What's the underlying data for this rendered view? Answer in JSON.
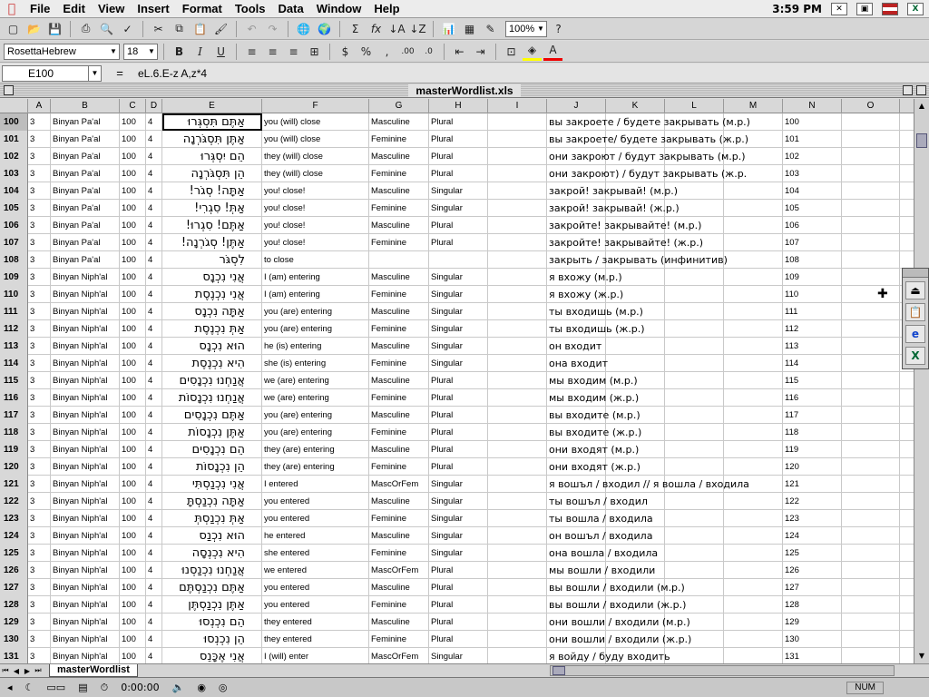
{
  "menubar": {
    "items": [
      "File",
      "Edit",
      "View",
      "Insert",
      "Format",
      "Tools",
      "Data",
      "Window",
      "Help"
    ],
    "clock": "3:59 PM"
  },
  "toolbar": {
    "zoom": "100%",
    "font": "RosettaHebrew",
    "size": "18"
  },
  "formula_bar": {
    "cell_ref": "E100",
    "equals": "=",
    "formula": "eL.6.E-z A,z*4"
  },
  "window": {
    "title": "masterWordlist.xls"
  },
  "columns": [
    "A",
    "B",
    "C",
    "D",
    "E",
    "F",
    "G",
    "H",
    "I",
    "J",
    "K",
    "L",
    "M",
    "N",
    "O"
  ],
  "rows": [
    {
      "n": "100",
      "a": "3",
      "b": "Binyan Pa'al",
      "c": "100",
      "d": "4",
      "e": "אַתֶּם תִּסְגְּרוּ",
      "f": "you (will) close",
      "g": "Masculine",
      "h": "Plural",
      "j": "вы закроете / будете закрывать (м.р.)"
    },
    {
      "n": "101",
      "a": "3",
      "b": "Binyan Pa'al",
      "c": "100",
      "d": "4",
      "e": "אַתֶּן תִּסְגֹּרְנָה",
      "f": "you (will) close",
      "g": "Feminine",
      "h": "Plural",
      "j": "вы закроете/ будете закрывать (ж.р.)"
    },
    {
      "n": "102",
      "a": "3",
      "b": "Binyan Pa'al",
      "c": "100",
      "d": "4",
      "e": "הֵם יִסְגְּרוּ",
      "f": "they (will) close",
      "g": "Masculine",
      "h": "Plural",
      "j": "они закроют / будут закрывать (м.р.)"
    },
    {
      "n": "103",
      "a": "3",
      "b": "Binyan Pa'al",
      "c": "100",
      "d": "4",
      "e": "הֵן תִּסְגֹּרְנָה",
      "f": "they (will) close",
      "g": "Feminine",
      "h": "Plural",
      "j": "они закроют) / будут закрывать (ж.р."
    },
    {
      "n": "104",
      "a": "3",
      "b": "Binyan Pa'al",
      "c": "100",
      "d": "4",
      "e": "אַתָּה! סְגֹר!",
      "f": "you! close!",
      "g": "Masculine",
      "h": "Singular",
      "j": "закрой! закрывай! (м.р.)"
    },
    {
      "n": "105",
      "a": "3",
      "b": "Binyan Pa'al",
      "c": "100",
      "d": "4",
      "e": "אַתְּ! סִגְרִי!",
      "f": "you! close!",
      "g": "Feminine",
      "h": "Singular",
      "j": "закрой! закрывай! (ж.р.)"
    },
    {
      "n": "106",
      "a": "3",
      "b": "Binyan Pa'al",
      "c": "100",
      "d": "4",
      "e": "אַתֶּם! סִגְרוּ!",
      "f": "you! close!",
      "g": "Masculine",
      "h": "Plural",
      "j": "закройте! закрывайте! (м.р.)"
    },
    {
      "n": "107",
      "a": "3",
      "b": "Binyan Pa'al",
      "c": "100",
      "d": "4",
      "e": "אַתֶּן! סְגֹרְנָה!",
      "f": "you! close!",
      "g": "Feminine",
      "h": "Plural",
      "j": "закройте! закрывайте! (ж.р.)"
    },
    {
      "n": "108",
      "a": "3",
      "b": "Binyan Pa'al",
      "c": "100",
      "d": "4",
      "e": "לִסְגֹּר",
      "f": "to close",
      "g": "",
      "h": "",
      "j": "закрыть / закрывать (инфинитив)"
    },
    {
      "n": "109",
      "a": "3",
      "b": "Binyan Niph'al",
      "c": "100",
      "d": "4",
      "e": "אֲנִי נִכְנָס",
      "f": "I (am) entering",
      "g": "Masculine",
      "h": "Singular",
      "j": "я вхожу (м.р.)"
    },
    {
      "n": "110",
      "a": "3",
      "b": "Binyan Niph'al",
      "c": "100",
      "d": "4",
      "e": "אֲנִי נִכְנֶסֶת",
      "f": "I (am) entering",
      "g": "Feminine",
      "h": "Singular",
      "j": "я вхожу (ж.р.)"
    },
    {
      "n": "111",
      "a": "3",
      "b": "Binyan Niph'al",
      "c": "100",
      "d": "4",
      "e": "אַתָּה נִכְנָס",
      "f": "you (are) entering",
      "g": "Masculine",
      "h": "Singular",
      "j": "ты входишь (м.р.)"
    },
    {
      "n": "112",
      "a": "3",
      "b": "Binyan Niph'al",
      "c": "100",
      "d": "4",
      "e": "אַתְּ נִכְנֶסֶת",
      "f": "you (are) entering",
      "g": "Feminine",
      "h": "Singular",
      "j": "ты входишь (ж.р.)"
    },
    {
      "n": "113",
      "a": "3",
      "b": "Binyan Niph'al",
      "c": "100",
      "d": "4",
      "e": "הוּא נִכְנָס",
      "f": "he (is) entering",
      "g": "Masculine",
      "h": "Singular",
      "j": "он входит"
    },
    {
      "n": "114",
      "a": "3",
      "b": "Binyan Niph'al",
      "c": "100",
      "d": "4",
      "e": "הִיא נִכְנֶסֶת",
      "f": "she (is) entering",
      "g": "Feminine",
      "h": "Singular",
      "j": "она входит"
    },
    {
      "n": "115",
      "a": "3",
      "b": "Binyan Niph'al",
      "c": "100",
      "d": "4",
      "e": "אֲנַחְנוּ נִכְנָסִים",
      "f": "we (are) entering",
      "g": "Masculine",
      "h": "Plural",
      "j": "мы входим (м.р.)"
    },
    {
      "n": "116",
      "a": "3",
      "b": "Binyan Niph'al",
      "c": "100",
      "d": "4",
      "e": "אֲנַחְנוּ נִכְנָסוֹת",
      "f": "we (are) entering",
      "g": "Feminine",
      "h": "Plural",
      "j": "мы входим (ж.р.)"
    },
    {
      "n": "117",
      "a": "3",
      "b": "Binyan Niph'al",
      "c": "100",
      "d": "4",
      "e": "אַתֶּם נִכְנָסִים",
      "f": "you (are) entering",
      "g": "Masculine",
      "h": "Plural",
      "j": "вы входите (м.р.)"
    },
    {
      "n": "118",
      "a": "3",
      "b": "Binyan Niph'al",
      "c": "100",
      "d": "4",
      "e": "אַתֶּן נִכְנָסוֹת",
      "f": "you (are) entering",
      "g": "Feminine",
      "h": "Plural",
      "j": "вы входите (ж.р.)"
    },
    {
      "n": "119",
      "a": "3",
      "b": "Binyan Niph'al",
      "c": "100",
      "d": "4",
      "e": "הֵם נִכְנָסִים",
      "f": "they (are) entering",
      "g": "Masculine",
      "h": "Plural",
      "j": "они входят (м.р.)"
    },
    {
      "n": "120",
      "a": "3",
      "b": "Binyan Niph'al",
      "c": "100",
      "d": "4",
      "e": "הֵן נִכְנָסוֹת",
      "f": "they (are) entering",
      "g": "Feminine",
      "h": "Plural",
      "j": "они входят (ж.р.)"
    },
    {
      "n": "121",
      "a": "3",
      "b": "Binyan Niph'al",
      "c": "100",
      "d": "4",
      "e": "אֲנִי נִכְנַסְתִּי",
      "f": "I entered",
      "g": "MascOrFem",
      "h": "Singular",
      "j": "я вошъл / входил  // я вошла / входила"
    },
    {
      "n": "122",
      "a": "3",
      "b": "Binyan Niph'al",
      "c": "100",
      "d": "4",
      "e": "אַתָּה נִכְנַסְתָּ",
      "f": "you entered",
      "g": "Masculine",
      "h": "Singular",
      "j": "ты вошъл / входил"
    },
    {
      "n": "123",
      "a": "3",
      "b": "Binyan Niph'al",
      "c": "100",
      "d": "4",
      "e": "אַתְּ נִכְנַסְתְּ",
      "f": "you entered",
      "g": "Feminine",
      "h": "Singular",
      "j": "ты вошла / входила"
    },
    {
      "n": "124",
      "a": "3",
      "b": "Binyan Niph'al",
      "c": "100",
      "d": "4",
      "e": "הוּא נִכְנַס",
      "f": "he entered",
      "g": "Masculine",
      "h": "Singular",
      "j": "он вошъл / входила"
    },
    {
      "n": "125",
      "a": "3",
      "b": "Binyan Niph'al",
      "c": "100",
      "d": "4",
      "e": "הִיא נִכְנְסָה",
      "f": "she entered",
      "g": "Feminine",
      "h": "Singular",
      "j": "она вошла / входила"
    },
    {
      "n": "126",
      "a": "3",
      "b": "Binyan Niph'al",
      "c": "100",
      "d": "4",
      "e": "אֲנַחְנוּ נִכְנַסְנוּ",
      "f": "we entered",
      "g": "MascOrFem",
      "h": "Plural",
      "j": "мы вошли / входили"
    },
    {
      "n": "127",
      "a": "3",
      "b": "Binyan Niph'al",
      "c": "100",
      "d": "4",
      "e": "אַתֶּם נִכְנַסְתֶּם",
      "f": "you entered",
      "g": "Masculine",
      "h": "Plural",
      "j": "вы вошли / входили (м.р.)"
    },
    {
      "n": "128",
      "a": "3",
      "b": "Binyan Niph'al",
      "c": "100",
      "d": "4",
      "e": "אַתֶּן נִכְנַסְתֶּן",
      "f": "you entered",
      "g": "Feminine",
      "h": "Plural",
      "j": "вы вошли / входили (ж.р.)"
    },
    {
      "n": "129",
      "a": "3",
      "b": "Binyan Niph'al",
      "c": "100",
      "d": "4",
      "e": "הֵם נִכְנְסוּ",
      "f": "they entered",
      "g": "Masculine",
      "h": "Plural",
      "j": "они вошли / входили (м.р.)"
    },
    {
      "n": "130",
      "a": "3",
      "b": "Binyan Niph'al",
      "c": "100",
      "d": "4",
      "e": "הֵן נִכְנְסוּ",
      "f": "they entered",
      "g": "Feminine",
      "h": "Plural",
      "j": "они вошли / входили (ж.р.)"
    },
    {
      "n": "131",
      "a": "3",
      "b": "Binyan Niph'al",
      "c": "100",
      "d": "4",
      "e": "אֲנִי אֶכָּנֵס",
      "f": "I (will) enter",
      "g": "MascOrFem",
      "h": "Singular",
      "j": "я войду / буду входить"
    }
  ],
  "sheet_tab": "masterWordlist",
  "control_strip": {
    "time": "0:00:00"
  },
  "status": {
    "num": "NUM"
  },
  "colors": {
    "selection": "#000000",
    "header_bg": "#d8d8d8"
  }
}
